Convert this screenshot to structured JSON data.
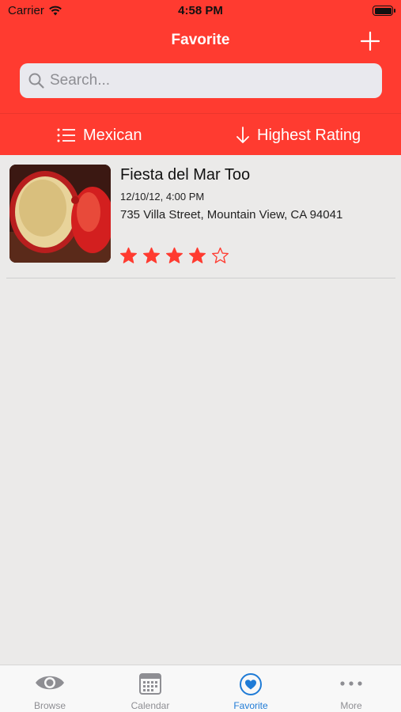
{
  "status_bar": {
    "carrier": "Carrier",
    "time": "4:58 PM"
  },
  "nav": {
    "title": "Favorite",
    "add_icon": "plus-icon"
  },
  "search": {
    "placeholder": "Search..."
  },
  "filters": {
    "cuisine_label": "Mexican",
    "cuisine_icon": "list-icon",
    "sort_label": "Highest Rating",
    "sort_icon": "arrow-down-icon"
  },
  "restaurants": [
    {
      "name": "Fiesta del Mar Too",
      "date": "12/10/12, 4:00 PM",
      "address": "735 Villa Street, Mountain View, CA 94041",
      "rating": 4,
      "rating_max": 5
    }
  ],
  "tabbar": {
    "tabs": [
      {
        "label": "Browse",
        "icon": "eye-icon"
      },
      {
        "label": "Calendar",
        "icon": "calendar-icon"
      },
      {
        "label": "Favorite",
        "icon": "heart-icon",
        "active": true
      },
      {
        "label": "More",
        "icon": "more-icon"
      }
    ]
  },
  "colors": {
    "accent": "#ff3b30",
    "tab_active": "#1f7bd6",
    "tab_inactive": "#8e8e93",
    "background": "#ebeae9"
  }
}
